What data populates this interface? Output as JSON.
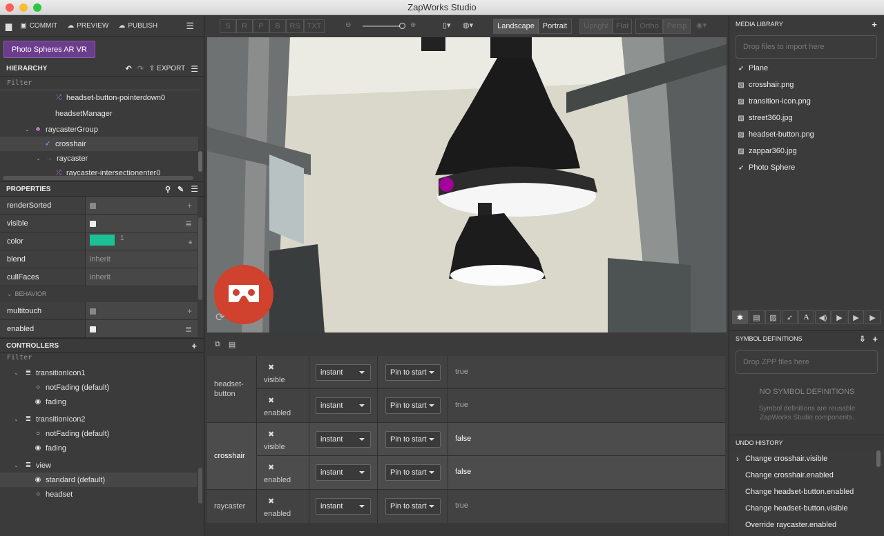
{
  "window": {
    "title": "ZapWorks Studio"
  },
  "toolbar": {
    "commit": "COMMIT",
    "preview": "PREVIEW",
    "publish": "PUBLISH"
  },
  "project_button": "Photo Spheres AR VR",
  "hierarchy": {
    "title": "HIERARCHY",
    "export": "EXPORT",
    "filter": "Filter",
    "items": [
      {
        "label": "headset-button-pointerdown0",
        "icon": "shuffle-icon"
      },
      {
        "label": "headsetManager",
        "icon": ""
      },
      {
        "label": "raycasterGroup",
        "icon": "group-icon"
      },
      {
        "label": "crosshair",
        "icon": "rocket-icon"
      },
      {
        "label": "raycaster",
        "icon": "arrow-right-icon"
      },
      {
        "label": "raycaster-intersectionenter0",
        "icon": "shuffle-icon"
      }
    ]
  },
  "properties": {
    "title": "PROPERTIES",
    "rows": [
      {
        "name": "renderSorted",
        "value": ""
      },
      {
        "name": "visible",
        "value": ""
      },
      {
        "name": "color",
        "value": "1",
        "swatch": "#1cc195"
      },
      {
        "name": "blend",
        "value": "inherit"
      },
      {
        "name": "cullFaces",
        "value": "inherit"
      }
    ],
    "behavior_label": "BEHAVIOR",
    "behavior_rows": [
      {
        "name": "multitouch",
        "value": ""
      },
      {
        "name": "enabled",
        "value": ""
      }
    ]
  },
  "controllers": {
    "title": "CONTROLLERS",
    "filter": "Filter",
    "groups": [
      {
        "name": "transitionIcon1",
        "states": [
          "notFading (default)",
          "fading"
        ]
      },
      {
        "name": "transitionIcon2",
        "states": [
          "notFading (default)",
          "fading"
        ]
      },
      {
        "name": "view",
        "states": [
          "standard (default)",
          "headset"
        ]
      }
    ]
  },
  "viewport": {
    "shading_buttons": [
      "S",
      "R",
      "P",
      "B",
      "RS",
      "TXT"
    ],
    "orientation": [
      "Landscape",
      "Portrait"
    ],
    "mode": [
      "Upright",
      "Flat"
    ],
    "projection": [
      "Ortho",
      "Persp"
    ],
    "zoom_pct": 0.9
  },
  "timeline": {
    "rows": [
      {
        "group": "headset-button",
        "prop": "visible",
        "ease": "instant",
        "pin": "Pin to start",
        "value": "true"
      },
      {
        "group": "",
        "prop": "enabled",
        "ease": "instant",
        "pin": "Pin to start",
        "value": "true"
      },
      {
        "group": "crosshair",
        "prop": "visible",
        "ease": "instant",
        "pin": "Pin to start",
        "value": "false"
      },
      {
        "group": "",
        "prop": "enabled",
        "ease": "instant",
        "pin": "Pin to start",
        "value": "false"
      },
      {
        "group": "raycaster",
        "prop": "enabled",
        "ease": "instant",
        "pin": "Pin to start",
        "value": "true"
      }
    ]
  },
  "media": {
    "title": "MEDIA LIBRARY",
    "drop": "Drop files to import here",
    "items": [
      {
        "label": "Plane",
        "icon": "rocket-icon"
      },
      {
        "label": "crosshair.png",
        "icon": "image-icon"
      },
      {
        "label": "transition-icon.png",
        "icon": "image-icon"
      },
      {
        "label": "street360.jpg",
        "icon": "image-icon"
      },
      {
        "label": "headset-button.png",
        "icon": "image-icon"
      },
      {
        "label": "zappar360.jpg",
        "icon": "image-icon"
      },
      {
        "label": "Photo Sphere",
        "icon": "rocket-icon"
      }
    ]
  },
  "symbols": {
    "title": "SYMBOL DEFINITIONS",
    "drop": "Drop ZPP files here",
    "empty": "NO SYMBOL DEFINITIONS",
    "hint": "Symbol definitions are reusable ZapWorks Studio components."
  },
  "undo": {
    "title": "UNDO HISTORY",
    "items": [
      "Change crosshair.visible",
      "Change crosshair.enabled",
      "Change headset-button.enabled",
      "Change headset-button.visible",
      "Override raycaster.enabled"
    ]
  }
}
